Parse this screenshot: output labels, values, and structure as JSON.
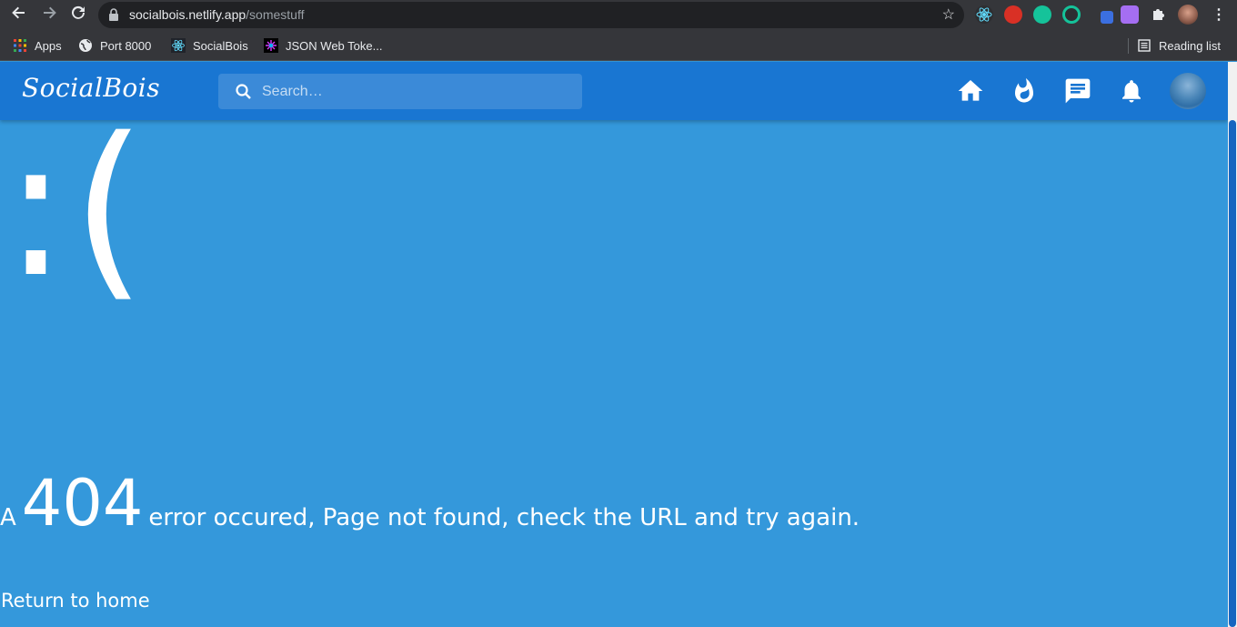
{
  "browser": {
    "url_host": "socialbois.netlify.app",
    "url_path": "/somestuff",
    "bookmarks": [
      {
        "label": "Apps",
        "icon": "apps-grid-icon"
      },
      {
        "label": "Port 8000",
        "icon": "globe-icon"
      },
      {
        "label": "SocialBois",
        "icon": "react-icon"
      },
      {
        "label": "JSON Web Toke...",
        "icon": "jwt-icon"
      }
    ],
    "reading_list": "Reading list"
  },
  "app": {
    "logo": "SocialBois",
    "search_placeholder": "Search…",
    "accent_color": "#1976d2",
    "background_color": "#3498db"
  },
  "error": {
    "face": ":(",
    "prefix": "A",
    "code": "404",
    "message": "error occured, Page not found, check the URL and try again.",
    "return_link": "Return to home"
  }
}
